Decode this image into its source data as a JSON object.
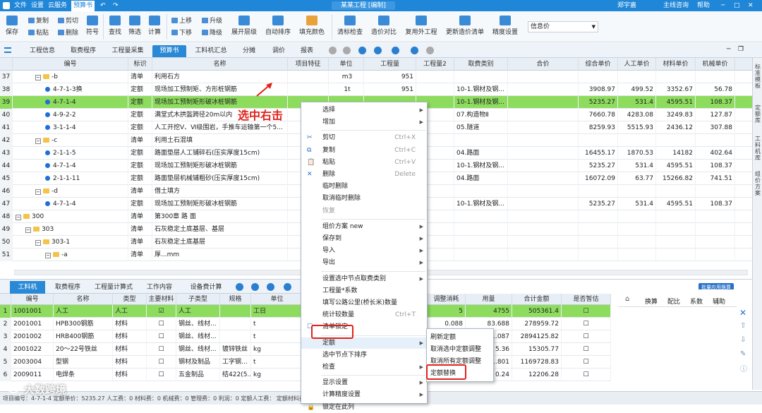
{
  "app": {
    "menu": [
      "文件",
      "设置",
      "云服务",
      "预算书"
    ],
    "active_menu": "预算书",
    "project": "某某工程 [编制]",
    "user": "郑宇嘉",
    "nav": [
      "主线咨询",
      "帮助"
    ]
  },
  "ribbon": {
    "save": "保存",
    "copy": "复制",
    "paste": "粘贴",
    "cut": "剪切",
    "delete": "删除",
    "symbol": "符号",
    "find": "查找",
    "filter": "筛选",
    "calc": "计算",
    "up": "上移",
    "down": "下移",
    "promote": "升级",
    "demote": "降级",
    "expand": "展开层级",
    "autosort": "自动排序",
    "fill": "填充颜色",
    "clear_check": "清标检查",
    "price_compare": "造价对比",
    "reuse": "复用外工程",
    "update": "更新造价清单",
    "precision": "精度设置",
    "info_label": "信息价"
  },
  "tabs": [
    "工程信息",
    "取费程序",
    "工程量采集",
    "预算书",
    "工料机汇总",
    "分摊",
    "调价",
    "报表"
  ],
  "active_tab": "预算书",
  "grid_columns": [
    "编号",
    "标识",
    "名称",
    "项目特征",
    "单位",
    "工程量",
    "工程量2",
    "取费类别",
    "合价",
    "综合单价",
    "人工单价",
    "材料单价",
    "机械单价"
  ],
  "rows": [
    {
      "n": "37",
      "lvl": 2,
      "icon": "folder",
      "code": "-b",
      "tag": "清单",
      "name": "利用石方",
      "unit": "m3",
      "qty": "951",
      "cat": "",
      "u": "",
      "lab": "",
      "mat": "",
      "mach": ""
    },
    {
      "n": "38",
      "lvl": 3,
      "icon": "dot",
      "code": "4-7-1-3换",
      "tag": "定额",
      "name": "现场加工预制矩、方形桩钢筋",
      "unit": "1t",
      "qty": "951",
      "cat": "10-1.钢材及钢...",
      "u": "3908.97",
      "lab": "499.52",
      "mat": "3352.67",
      "mach": "56.78"
    },
    {
      "n": "39",
      "lvl": 3,
      "icon": "dot",
      "code": "4-7-1-4",
      "tag": "定额",
      "name": "现场加工预制矩形破冰桩钢筋",
      "unit": "",
      "qty": "",
      "cat": "10-1.钢材及钢...",
      "u": "5235.27",
      "lab": "531.4",
      "mat": "4595.51",
      "mach": "108.37",
      "sel": true
    },
    {
      "n": "40",
      "lvl": 3,
      "icon": "dot",
      "code": "4-9-2-2",
      "tag": "定额",
      "name": "满堂式木拱盔跨径20m以内",
      "unit": "",
      "qty": "",
      "cat": "07.构造物Ⅱ",
      "u": "7660.78",
      "lab": "4283.08",
      "mat": "3249.83",
      "mach": "127.87"
    },
    {
      "n": "41",
      "lvl": 3,
      "icon": "dot",
      "code": "3-1-1-4",
      "tag": "定额",
      "name": "人工开挖Ⅴ、Ⅵ级围岩，手推车运输第一个5...",
      "unit": "",
      "qty": "",
      "cat": "05.隧道",
      "u": "8259.93",
      "lab": "5515.93",
      "mat": "2436.12",
      "mach": "307.88"
    },
    {
      "n": "42",
      "lvl": 2,
      "icon": "folder",
      "code": "-c",
      "tag": "清单",
      "name": "利用土石混填",
      "unit": "",
      "qty": "",
      "cat": "",
      "u": "",
      "lab": "",
      "mat": "",
      "mach": ""
    },
    {
      "n": "43",
      "lvl": 3,
      "icon": "dot",
      "code": "2-1-1-5",
      "tag": "定额",
      "name": "路面垫层人工铺碎石(压实厚度15cm)",
      "unit": "",
      "qty": "",
      "cat": "04.路面",
      "u": "16455.17",
      "lab": "1870.53",
      "mat": "14182",
      "mach": "402.64"
    },
    {
      "n": "44",
      "lvl": 3,
      "icon": "dot",
      "code": "4-7-1-4",
      "tag": "定额",
      "name": "现场加工预制矩形破冰桩钢筋",
      "unit": "",
      "qty": "",
      "cat": "10-1.钢材及钢...",
      "u": "5235.27",
      "lab": "531.4",
      "mat": "4595.51",
      "mach": "108.37"
    },
    {
      "n": "45",
      "lvl": 3,
      "icon": "dot",
      "code": "2-1-1-11",
      "tag": "定额",
      "name": "路面垫层机械铺粗砂(压实厚度15cm)",
      "unit": "",
      "qty": "",
      "cat": "04.路面",
      "u": "16072.09",
      "lab": "63.77",
      "mat": "15266.82",
      "mach": "741.51"
    },
    {
      "n": "46",
      "lvl": 2,
      "icon": "folder",
      "code": "-d",
      "tag": "清单",
      "name": "借土填方",
      "unit": "",
      "qty": "",
      "cat": "",
      "u": "",
      "lab": "",
      "mat": "",
      "mach": ""
    },
    {
      "n": "47",
      "lvl": 3,
      "icon": "dot",
      "code": "4-7-1-4",
      "tag": "定额",
      "name": "现场加工预制矩形破冰桩钢筋",
      "unit": "",
      "qty": "",
      "cat": "10-1.钢材及钢...",
      "u": "5235.27",
      "lab": "531.4",
      "mat": "4595.51",
      "mach": "108.37"
    },
    {
      "n": "48",
      "lvl": 0,
      "icon": "folder",
      "code": "300",
      "tag": "清单",
      "name": "第300章 路 面",
      "unit": "",
      "qty": "",
      "cat": "",
      "u": "",
      "lab": "",
      "mat": "",
      "mach": ""
    },
    {
      "n": "49",
      "lvl": 1,
      "icon": "folder",
      "code": "303",
      "tag": "清单",
      "name": "石灰稳定土底基层、基层",
      "unit": "",
      "qty": "",
      "cat": "",
      "u": "",
      "lab": "",
      "mat": "",
      "mach": ""
    },
    {
      "n": "50",
      "lvl": 2,
      "icon": "folder",
      "code": "303-1",
      "tag": "清单",
      "name": "石灰稳定土底基层",
      "unit": "",
      "qty": "",
      "cat": "",
      "u": "",
      "lab": "",
      "mat": "",
      "mach": ""
    },
    {
      "n": "51",
      "lvl": 3,
      "icon": "folder",
      "code": "-a",
      "tag": "清单",
      "name": "厚...mm",
      "unit": "",
      "qty": "",
      "cat": "",
      "u": "",
      "lab": "",
      "mat": "",
      "mach": ""
    }
  ],
  "annotation": "选中右击",
  "context_menu": [
    {
      "label": "选择",
      "arrow": true
    },
    {
      "label": "增加",
      "arrow": true
    },
    {
      "sep": true
    },
    {
      "label": "剪切",
      "shortcut": "Ctrl+X",
      "icon": "✂"
    },
    {
      "label": "复制",
      "shortcut": "Ctrl+C",
      "icon": "⧉"
    },
    {
      "label": "粘贴",
      "shortcut": "Ctrl+V",
      "icon": "📋"
    },
    {
      "label": "删除",
      "shortcut": "Delete",
      "icon": "✕"
    },
    {
      "label": "临时删除"
    },
    {
      "label": "取消临时删除"
    },
    {
      "label": "恢复",
      "disabled": true
    },
    {
      "sep": true
    },
    {
      "label": "组价方案 new",
      "arrow": true
    },
    {
      "label": "保存到",
      "arrow": true
    },
    {
      "label": "导入",
      "arrow": true
    },
    {
      "label": "导出",
      "arrow": true
    },
    {
      "sep": true
    },
    {
      "label": "设置选中节点取费类别",
      "arrow": true
    },
    {
      "label": "工程量*系数"
    },
    {
      "label": "填写公路公里(桥长米)数量"
    },
    {
      "label": "统计较数量",
      "shortcut": "Ctrl+T"
    },
    {
      "label": "清单锁定",
      "icon": "☐"
    },
    {
      "sep": true
    },
    {
      "label": "定额",
      "arrow": true,
      "hl": true
    },
    {
      "label": "选中节点下排序"
    },
    {
      "label": "检查",
      "arrow": true
    },
    {
      "sep": true
    },
    {
      "label": "显示设置",
      "arrow": true
    },
    {
      "label": "计算精度设置",
      "arrow": true
    },
    {
      "label": "锁定在此列",
      "icon": "🔒"
    }
  ],
  "submenu": [
    "刷新定额",
    "取消选中定额调整",
    "取消所有定额调整",
    "定额替换"
  ],
  "bottom_tabs": [
    "工料机",
    "取费程序",
    "工程量计算式",
    "工作内容",
    "设备费计算"
  ],
  "bottom_columns": [
    "编号",
    "名称",
    "类型",
    "主要材料",
    "子类型",
    "规格",
    "单位"
  ],
  "bottom_rows": [
    {
      "n": "1",
      "code": "1001001",
      "name": "人工",
      "type": "人工",
      "main": "☑",
      "sub": "人工",
      "spec": "",
      "unit": "工日",
      "q1": "5",
      "q2": "4755",
      "total": "505361.4",
      "sel": true
    },
    {
      "n": "2",
      "code": "2001001",
      "name": "HPB300钢筋",
      "type": "材料",
      "main": "☐",
      "sub": "钢丝、线材...",
      "spec": "",
      "unit": "t",
      "q1": "0.088",
      "q2": "83.688",
      "total": "278959.72"
    },
    {
      "n": "3",
      "code": "2001002",
      "name": "HRB400钢筋",
      "type": "材料",
      "main": "☐",
      "sub": "钢丝、线材...",
      "spec": "",
      "unit": "t",
      "q1": "",
      "q2": "1.087",
      "total": "2894125.82"
    },
    {
      "n": "4",
      "code": "2001022",
      "name": "20～22号铁丝",
      "type": "材料",
      "main": "☐",
      "sub": "钢丝、线材...",
      "spec": "镀锌铁丝",
      "unit": "kg",
      "q1": "",
      "q2": "5.36",
      "total": "15305.77"
    },
    {
      "n": "5",
      "code": "2003004",
      "name": "型钢",
      "type": "材料",
      "main": "☐",
      "sub": "钢材及制品",
      "spec": "工字钢...",
      "unit": "t",
      "q1": "",
      "q2": "1.801",
      "total": "1169728.83"
    },
    {
      "n": "6",
      "code": "2009011",
      "name": "电焊条",
      "type": "材料",
      "main": "☐",
      "sub": "五金制品",
      "spec": "结422(5...",
      "unit": "kg",
      "q1": "",
      "q2": "0.24",
      "total": "12206.28"
    }
  ],
  "bottom_right_cols": [
    "调整消耗",
    "用量",
    "合计金额",
    "是否暂估"
  ],
  "right_panel_tabs": [
    "换算",
    "配比",
    "系数",
    "辅助"
  ],
  "right_panel_btn": "批量应用换算",
  "sidebar_labels": [
    "标准模板",
    "定额库",
    "工料机库",
    "组价方案"
  ],
  "status": "项目编号：4-7-1-4  定额单价：5235.27  人工费：0  材料费：0  机械费：0  管理费：0  利润：0  定额人工费：     定额材料费：     定额机械费：     ",
  "watermark": "大数跨境"
}
